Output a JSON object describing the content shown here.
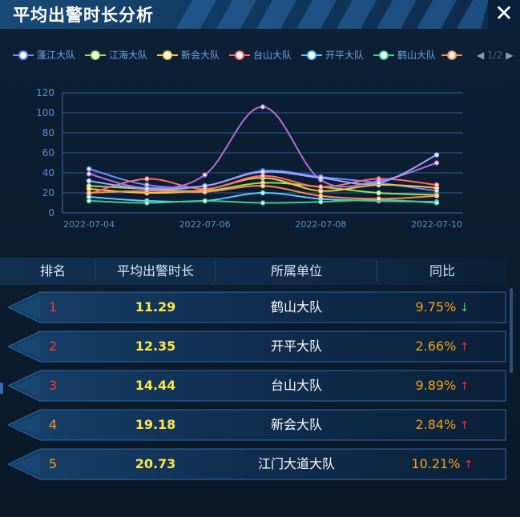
{
  "title": "平均出警时长分析",
  "close_icon": "close-icon",
  "legend": {
    "items": [
      {
        "label": "蓬江大队",
        "color": "#6a8cff"
      },
      {
        "label": "江海大队",
        "color": "#9be05a"
      },
      {
        "label": "新会大队",
        "color": "#f5c542"
      },
      {
        "label": "台山大队",
        "color": "#ff6b6b"
      },
      {
        "label": "开平大队",
        "color": "#5ec8ff"
      },
      {
        "label": "鹤山大队",
        "color": "#3ecf8e"
      },
      {
        "label": "",
        "color": "#ff8a4c"
      }
    ],
    "page": "1/2"
  },
  "chart_data": {
    "type": "line",
    "x": [
      "2022-07-04",
      "2022-07-05",
      "2022-07-06",
      "2022-07-07",
      "2022-07-08",
      "2022-07-09",
      "2022-07-10"
    ],
    "x_tick_labels": [
      "2022-07-04",
      "2022-07-06",
      "2022-07-08",
      "2022-07-10"
    ],
    "ylim": [
      0,
      120
    ],
    "yticks": [
      0,
      20,
      40,
      60,
      80,
      100,
      120
    ],
    "grid": true,
    "series": [
      {
        "name": "蓬江大队",
        "color": "#6a8cff",
        "values": [
          44,
          28,
          27,
          42,
          36,
          30,
          22
        ]
      },
      {
        "name": "江海大队",
        "color": "#9be05a",
        "values": [
          27,
          24,
          22,
          30,
          26,
          20,
          18
        ]
      },
      {
        "name": "新会大队",
        "color": "#f5c542",
        "values": [
          24,
          20,
          23,
          35,
          22,
          28,
          25
        ]
      },
      {
        "name": "台山大队",
        "color": "#ff6b6b",
        "values": [
          19,
          34,
          24,
          37,
          26,
          34,
          28
        ]
      },
      {
        "name": "开平大队",
        "color": "#5ec8ff",
        "values": [
          16,
          12,
          12,
          20,
          14,
          12,
          11
        ]
      },
      {
        "name": "鹤山大队",
        "color": "#3ecf8e",
        "values": [
          12,
          10,
          12,
          10,
          11,
          13,
          10
        ]
      },
      {
        "name": "",
        "color": "#ff8a4c",
        "values": [
          20,
          22,
          21,
          27,
          17,
          14,
          17
        ]
      },
      {
        "name": "",
        "color": "#b06fd8",
        "values": [
          39,
          25,
          38,
          106,
          33,
          32,
          50
        ]
      },
      {
        "name": "",
        "color": "#9aa8ff",
        "values": [
          32,
          24,
          27,
          41,
          35,
          30,
          58
        ]
      }
    ]
  },
  "table": {
    "headers": [
      "排名",
      "平均出警时长",
      "所属单位",
      "同比"
    ],
    "rows": [
      {
        "rank": "1",
        "value": "11.29",
        "unit": "鹤山大队",
        "pct": "9.75%",
        "trend": "down"
      },
      {
        "rank": "2",
        "value": "12.35",
        "unit": "开平大队",
        "pct": "2.66%",
        "trend": "up"
      },
      {
        "rank": "3",
        "value": "14.44",
        "unit": "台山大队",
        "pct": "9.89%",
        "trend": "up"
      },
      {
        "rank": "4",
        "value": "19.18",
        "unit": "新会大队",
        "pct": "2.84%",
        "trend": "up"
      },
      {
        "rank": "5",
        "value": "20.73",
        "unit": "江门大道大队",
        "pct": "10.21%",
        "trend": "up"
      }
    ]
  }
}
